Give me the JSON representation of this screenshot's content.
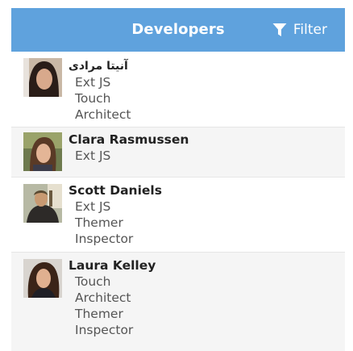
{
  "header": {
    "title": "Developers",
    "filter_label": "Filter",
    "filter_icon": "filter-icon",
    "background": "#5fa2dd"
  },
  "developers": [
    {
      "name": "آنیتا مرادی",
      "skills": [
        "Ext JS",
        "Touch",
        "Architect"
      ],
      "avatar": "avatar-photo"
    },
    {
      "name": "Clara Rasmussen",
      "skills": [
        "Ext JS"
      ],
      "avatar": "avatar-photo"
    },
    {
      "name": "Scott Daniels",
      "skills": [
        "Ext JS",
        "Themer",
        "Inspector"
      ],
      "avatar": "avatar-photo"
    },
    {
      "name": "Laura Kelley",
      "skills": [
        "Touch",
        "Architect",
        "Themer",
        "Inspector"
      ],
      "avatar": "avatar-photo"
    }
  ]
}
